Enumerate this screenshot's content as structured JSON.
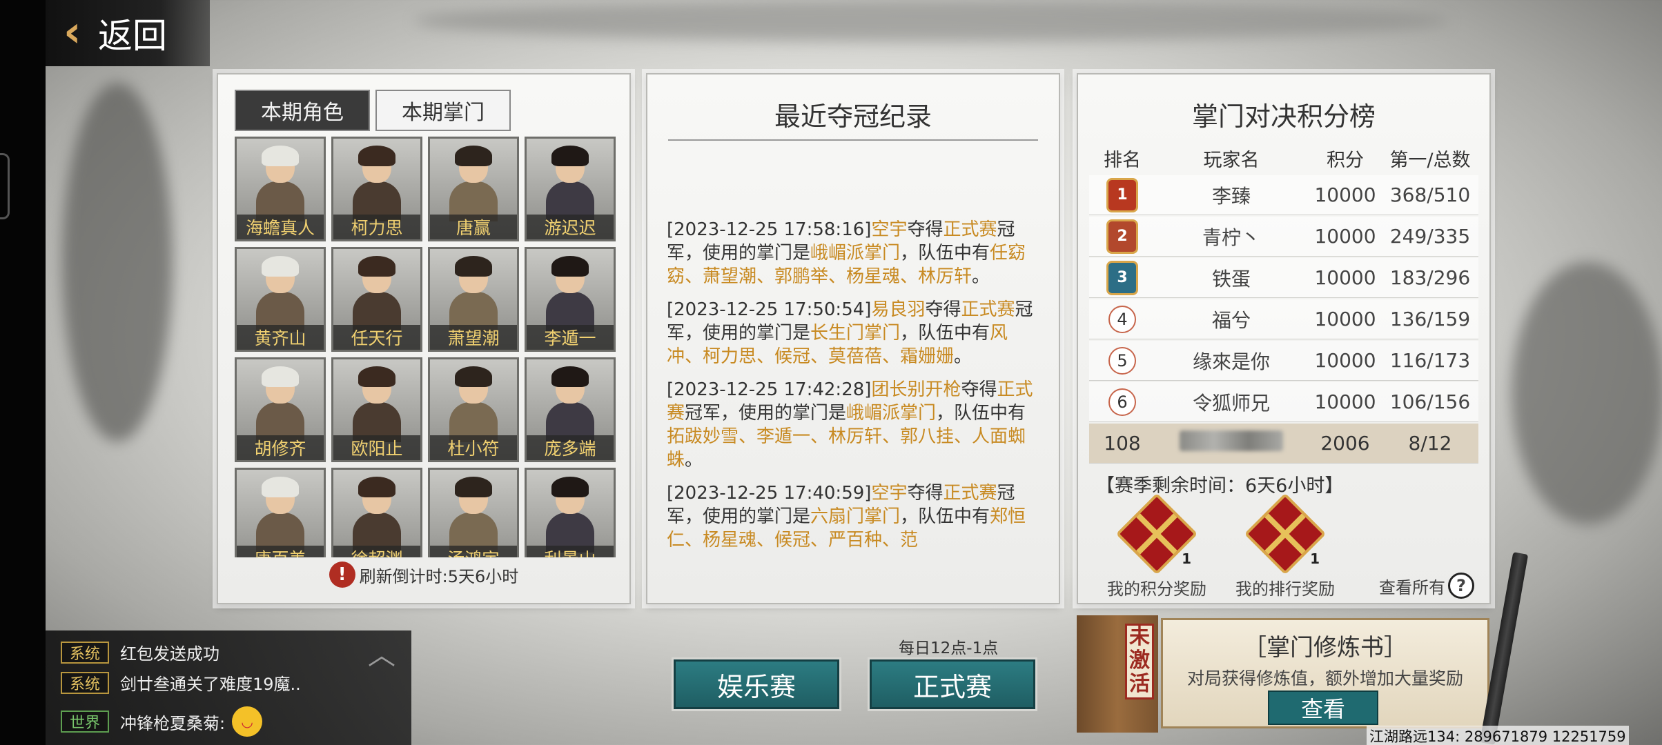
{
  "header": {
    "back_label": "返回"
  },
  "roster": {
    "tabs": [
      {
        "label": "本期角色",
        "active": true
      },
      {
        "label": "本期掌门",
        "active": false
      }
    ],
    "characters": [
      {
        "name": "海蟾真人"
      },
      {
        "name": "柯力思"
      },
      {
        "name": "唐赢"
      },
      {
        "name": "游迟迟"
      },
      {
        "name": "黄齐山"
      },
      {
        "name": "任天行"
      },
      {
        "name": "萧望潮"
      },
      {
        "name": "李遁一"
      },
      {
        "name": "胡修齐"
      },
      {
        "name": "欧阳止"
      },
      {
        "name": "杜小符"
      },
      {
        "name": "庞多端"
      },
      {
        "name": "唐百美"
      },
      {
        "name": "徐超渊"
      },
      {
        "name": "汤鸿宇"
      },
      {
        "name": "利景山"
      }
    ],
    "refresh_label": "刷新倒计时: ",
    "refresh_value": "5天6小时"
  },
  "records": {
    "title": "最近夺冠纪录",
    "items": [
      {
        "time": "[2023-12-25 17:58:16]",
        "player": "空宇",
        "won": "夺得",
        "event": "正式赛",
        "mid1": "冠军，使用的掌门是",
        "sect": "峨嵋派掌门",
        "mid2": "，队伍中有",
        "team": "任窈窈、萧望潮、郭鹏举、杨星魂、林厉轩",
        "end": "。"
      },
      {
        "time": "[2023-12-25 17:50:54]",
        "player": "易良羽",
        "won": "夺得",
        "event": "正式赛",
        "mid1": "冠军，使用的掌门是",
        "sect": "长生门掌门",
        "mid2": "，队伍中有",
        "team": "风冲、柯力思、候冠、莫蓓蓓、霜姗姗",
        "end": "。"
      },
      {
        "time": "[2023-12-25 17:42:28]",
        "player": "团长别开枪",
        "won": "夺得",
        "event": "正式赛",
        "mid1": "冠军，使用的掌门是",
        "sect": "峨嵋派掌门",
        "mid2": "，队伍中有",
        "team": "拓跋妙雪、李遁一、林厉轩、郭八挂、人面蜘蛛",
        "end": "。"
      },
      {
        "time": "[2023-12-25 17:40:59]",
        "player": "空宇",
        "won": "夺得",
        "event": "正式赛",
        "mid1": "冠军，使用的掌门是",
        "sect": "六扇门掌门",
        "mid2": "，队伍中有",
        "team": "郑恒仁、杨星魂、候冠、严百种、范",
        "end": ""
      }
    ]
  },
  "leaderboard": {
    "title": "掌门对决积分榜",
    "headers": {
      "rank": "排名",
      "player": "玩家名",
      "score": "积分",
      "ratio": "第一/总数"
    },
    "rows": [
      {
        "rank": "1",
        "player": "李臻",
        "score": "10000",
        "ratio": "368/510"
      },
      {
        "rank": "2",
        "player": "青柠丶",
        "score": "10000",
        "ratio": "249/335"
      },
      {
        "rank": "3",
        "player": "铁蛋",
        "score": "10000",
        "ratio": "183/296"
      },
      {
        "rank": "4",
        "player": "福兮",
        "score": "10000",
        "ratio": "136/159"
      },
      {
        "rank": "5",
        "player": "缘來是你",
        "score": "10000",
        "ratio": "116/173"
      },
      {
        "rank": "6",
        "player": "令狐师兄",
        "score": "10000",
        "ratio": "106/156"
      }
    ],
    "my_row": {
      "rank": "108",
      "score": "2006",
      "ratio": "8/12"
    },
    "season_label": "【赛季剩余时间：6天6小时】",
    "rewards": [
      {
        "label": "我的积分奖励",
        "count": "1"
      },
      {
        "label": "我的排行奖励",
        "count": "1"
      }
    ],
    "view_all": "查看所有"
  },
  "chat": {
    "lines": [
      {
        "channel": "系统",
        "text": "红包发送成功"
      },
      {
        "channel": "系统",
        "text": "剑廿叁通关了难度19魔.."
      },
      {
        "channel": "世界",
        "text": "冲锋枪夏桑菊:"
      }
    ]
  },
  "schedule_note": "每日12点-1点",
  "buttons": {
    "casual": "娱乐赛",
    "official": "正式赛"
  },
  "book": {
    "stamp": "未激活",
    "title": "［掌门修炼书］",
    "desc": "对局获得修炼值，额外增加大量奖励",
    "view": "查看"
  },
  "footer": "江湖路远134: 289671879  12251759"
}
